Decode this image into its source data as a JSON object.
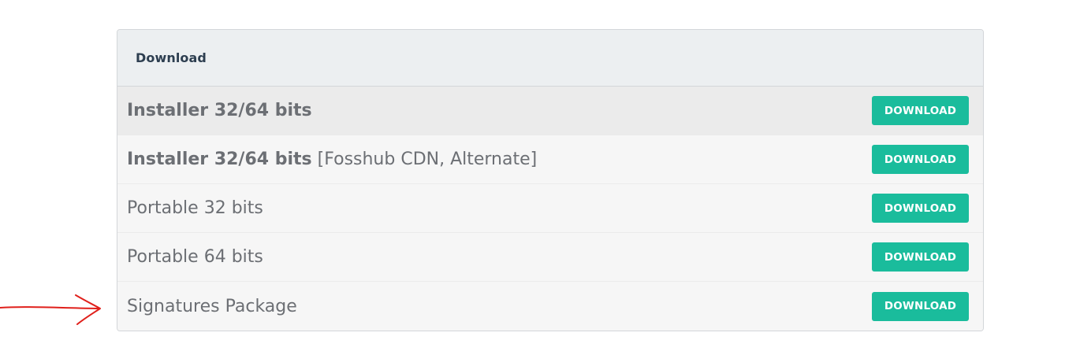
{
  "panel": {
    "title": "Download"
  },
  "rows": [
    {
      "bold": "Installer 32/64 bits",
      "extra": "",
      "button": "DOWNLOAD",
      "highlighted": true
    },
    {
      "bold": "Installer 32/64 bits",
      "extra": " [Fosshub CDN, Alternate]",
      "button": "DOWNLOAD",
      "highlighted": false
    },
    {
      "bold": "",
      "extra": "Portable 32 bits",
      "button": "DOWNLOAD",
      "highlighted": false
    },
    {
      "bold": "",
      "extra": "Portable 64 bits",
      "button": "DOWNLOAD",
      "highlighted": false
    },
    {
      "bold": "",
      "extra": "Signatures Package",
      "button": "DOWNLOAD",
      "highlighted": false
    }
  ],
  "annotation": {
    "icon": "hand-drawn-arrow-icon",
    "color": "#e0201b"
  },
  "colors": {
    "button": "#1abc9c",
    "header_bg": "#eceff1",
    "title": "#2d3e50",
    "row_text": "#6c6f74"
  }
}
